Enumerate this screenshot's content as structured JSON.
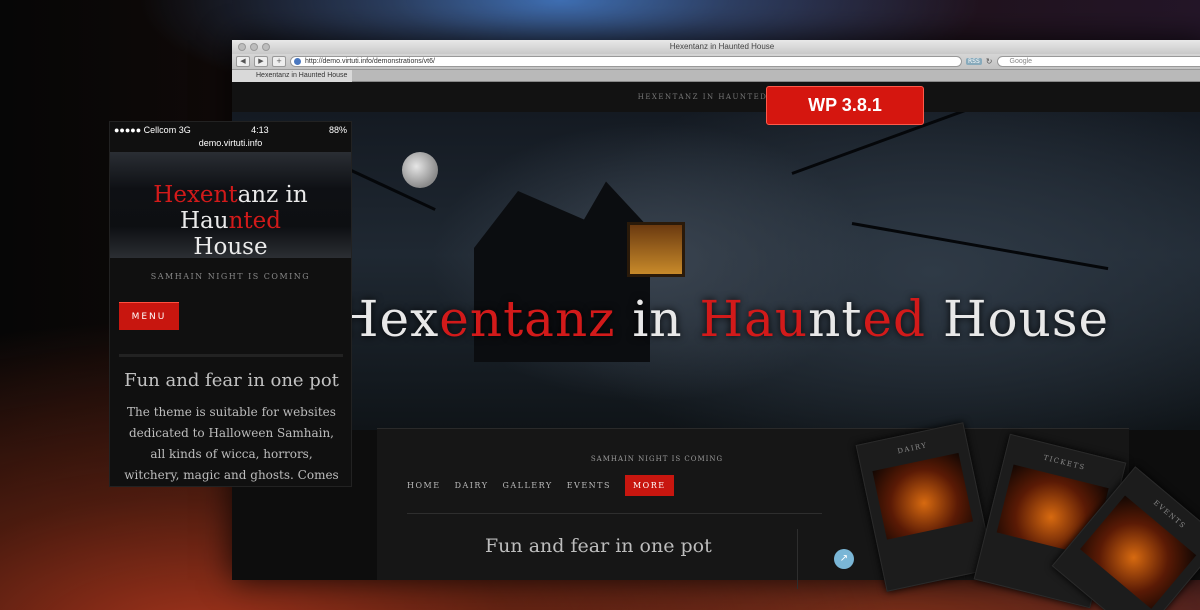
{
  "browser": {
    "window_title": "Hexentanz in Haunted House",
    "url": "http://demo.virtuti.info/demonstrations/vt6/",
    "rss_label": "RSS",
    "search_placeholder": "Google",
    "tab_label": "Hexentanz in Haunted House"
  },
  "site": {
    "top_heading": "HEXENTANZ IN HAUNTED HOUSE",
    "hero_title_parts": [
      "Hex",
      "entanz",
      " in ",
      "Hau",
      "nt",
      "ed",
      " House"
    ],
    "tagline": "SAMHAIN NIGHT IS COMING",
    "nav": [
      "HOME",
      "DAIRY",
      "GALLERY",
      "EVENTS",
      "MORE"
    ],
    "post_title": "Fun and fear in one pot",
    "cards": [
      "DAIRY",
      "TICKETS",
      "EVENTS"
    ]
  },
  "badge": {
    "label": "WP 3.8.1",
    "color": "#d5160f"
  },
  "phone": {
    "carrier": "●●●●● Cellcom  3G",
    "time": "4:13",
    "battery": "88%",
    "url": "demo.virtuti.info",
    "title_line1_parts": [
      "Hexent",
      "anz in Hau",
      "nted"
    ],
    "title_line2": "House",
    "tagline": "SAMHAIN NIGHT IS COMING",
    "menu_label": "MENU",
    "post_title": "Fun and fear in one pot",
    "post_body": "The theme is suitable for websites dedicated to Halloween Samhain, all kinds of wicca, horrors, witchery, magic and ghosts. Comes with optional page"
  },
  "colors": {
    "accent": "#c8160f",
    "title_red": "#d21a1a"
  }
}
